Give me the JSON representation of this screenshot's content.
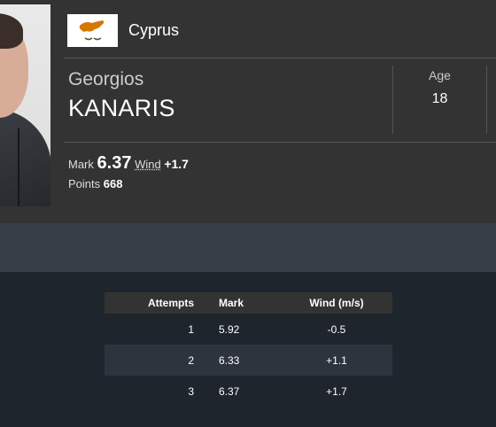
{
  "athlete": {
    "country": "Cyprus",
    "first_name": "Georgios",
    "last_name": "KANARIS",
    "age_label": "Age",
    "age_value": "18"
  },
  "result": {
    "mark_label": "Mark",
    "mark_value": "6.37",
    "wind_label": "Wind",
    "wind_value": "+1.7",
    "points_label": "Points",
    "points_value": "668"
  },
  "attempts_table": {
    "headers": [
      "Attempts",
      "Mark",
      "Wind (m/s)"
    ],
    "rows": [
      {
        "attempt": "1",
        "mark": "5.92",
        "wind": "-0.5"
      },
      {
        "attempt": "2",
        "mark": "6.33",
        "wind": "+1.1"
      },
      {
        "attempt": "3",
        "mark": "6.37",
        "wind": "+1.7"
      }
    ]
  },
  "colors": {
    "header_bg": "#333333",
    "band_bg": "#363e48",
    "page_bg": "#1f252d",
    "flag_copper": "#d57800",
    "flag_olive": "#4e5b31"
  }
}
